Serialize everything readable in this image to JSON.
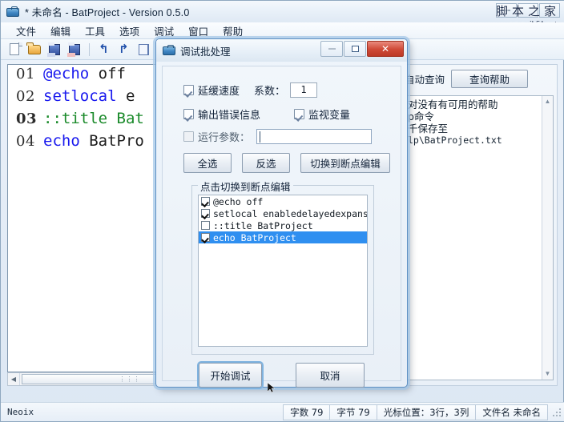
{
  "window": {
    "title": "* 未命名 - BatProject - Version 0.5.0",
    "icon": "briefcase-icon",
    "minimize_label": "",
    "watermark_zh": "脚本之家",
    "watermark_url": "www.jb51.net"
  },
  "menu": {
    "items": [
      {
        "label": "文件",
        "name": "menu-file"
      },
      {
        "label": "编辑",
        "name": "menu-edit"
      },
      {
        "label": "工具",
        "name": "menu-tools"
      },
      {
        "label": "选项",
        "name": "menu-options"
      },
      {
        "label": "调试",
        "name": "menu-debug"
      },
      {
        "label": "窗口",
        "name": "menu-window"
      },
      {
        "label": "帮助",
        "name": "menu-help"
      }
    ]
  },
  "toolbar": {
    "icons": [
      "new-file-icon",
      "open-folder-icon",
      "save-icon",
      "save-as-icon",
      "undo-icon",
      "redo-icon",
      "copy-icon",
      "paste-icon"
    ],
    "undo_glyph": "↰",
    "redo_glyph": "↱"
  },
  "editor": {
    "lines": [
      {
        "no": "01",
        "current": false,
        "parts": [
          {
            "t": "@echo ",
            "c": "kw"
          },
          {
            "t": "off",
            "c": "tx"
          }
        ]
      },
      {
        "no": "02",
        "current": false,
        "parts": [
          {
            "t": "setlocal ",
            "c": "kw"
          },
          {
            "t": "e",
            "c": "tx"
          }
        ]
      },
      {
        "no": "03",
        "current": true,
        "parts": [
          {
            "t": "::title Bat",
            "c": "cm"
          }
        ]
      },
      {
        "no": "04",
        "current": false,
        "parts": [
          {
            "t": "echo ",
            "c": "kw"
          },
          {
            "t": "BatPro",
            "c": "tx"
          }
        ]
      }
    ],
    "hscroll_thumb_glyph": "⋮⋮⋮",
    "left_arrow": "◀",
    "right_arrow": "▶"
  },
  "help_panel": {
    "auto_query_label": "自动查询",
    "query_help_label": "查询帮助",
    "lines": [
      "对没有有可用的帮助",
      "p命令",
      "千保存至",
      "lp\\BatProject.txt"
    ],
    "scroll_up_glyph": "▲",
    "scroll_down_glyph": "▼"
  },
  "status_bar": {
    "left_text": "Neoix",
    "cells": [
      "字数 79",
      "字节 79",
      "光标位置：3行，3列",
      "文件名 未命名"
    ]
  },
  "dialog": {
    "title": "调试批处理",
    "icon": "briefcase-icon",
    "close_glyph": "✕",
    "delay_speed": {
      "label": "延缓速度",
      "checked": true
    },
    "coefficient": {
      "label": "系数：",
      "value": "1"
    },
    "output_error": {
      "label": "输出错误信息",
      "checked": true
    },
    "watch_variable": {
      "label": "监视变量",
      "checked": true
    },
    "run_params": {
      "label": "运行参数：",
      "checked": false,
      "value": "",
      "placeholder": ""
    },
    "buttons": {
      "select_all": "全选",
      "invert": "反选",
      "toggle_breakpoint": "切换到断点编辑",
      "start_debug": "开始调试",
      "cancel": "取消"
    },
    "group_title": "点击切换到断点编辑",
    "breakpoints": [
      {
        "text": "@echo off",
        "checked": true,
        "selected": false
      },
      {
        "text": "setlocal enabledelayedexpansion",
        "checked": true,
        "selected": false
      },
      {
        "text": "::title BatProject",
        "checked": false,
        "selected": false
      },
      {
        "text": "echo BatProject",
        "checked": true,
        "selected": true
      }
    ]
  },
  "colors": {
    "accent": "#2f8ff0",
    "keyword": "#1818ee",
    "comment": "#1a8a2a",
    "close_button": "#d04b38",
    "focus_ring": "#7fb3e0"
  }
}
